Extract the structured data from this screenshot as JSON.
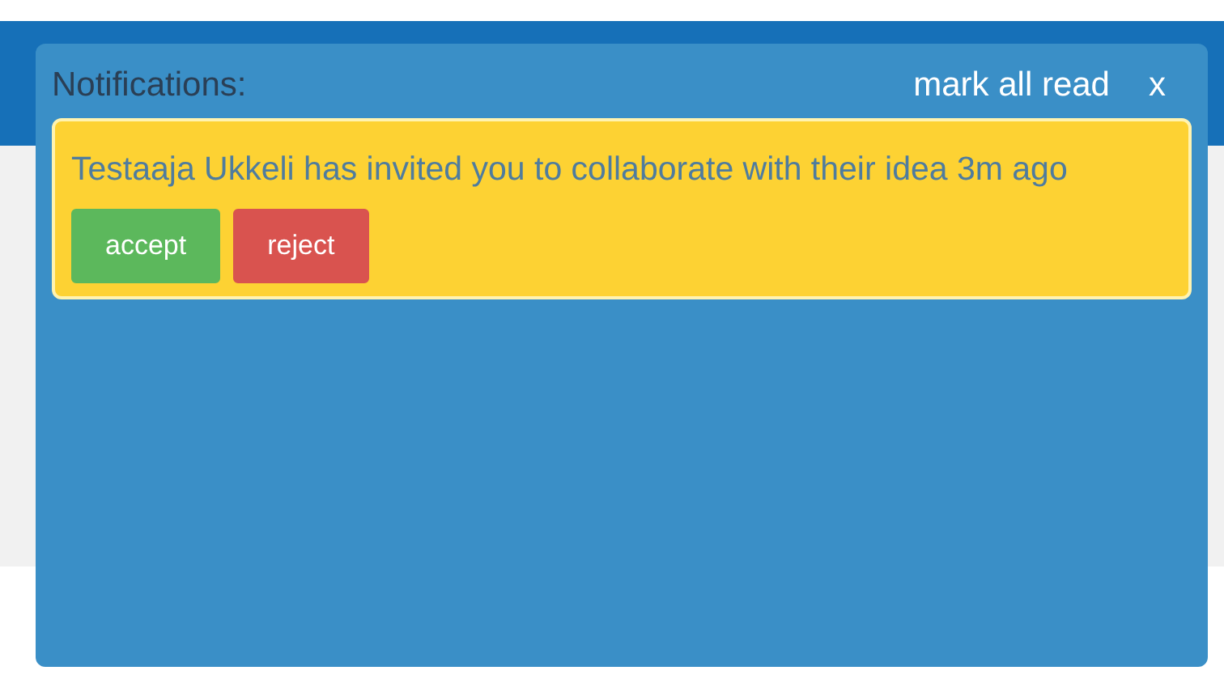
{
  "notifications_panel": {
    "title": "Notifications:",
    "mark_all_read": "mark all read",
    "close": "x",
    "items": [
      {
        "message": "Testaaja Ukkeli has invited you to collaborate with their idea",
        "time": "3m ago",
        "actions": [
          {
            "label": "accept",
            "kind": "accept"
          },
          {
            "label": "reject",
            "kind": "reject"
          }
        ]
      }
    ]
  }
}
